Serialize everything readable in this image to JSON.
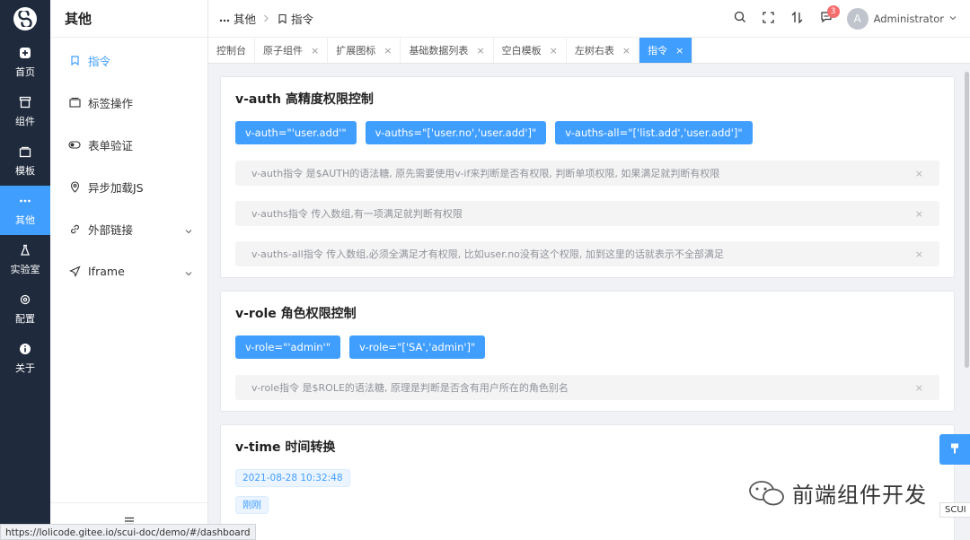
{
  "rail": {
    "items": [
      {
        "label": "首页",
        "icon": "home-icon"
      },
      {
        "label": "组件",
        "icon": "components-icon"
      },
      {
        "label": "模板",
        "icon": "template-icon"
      },
      {
        "label": "其他",
        "icon": "more-icon"
      },
      {
        "label": "实验室",
        "icon": "lab-icon"
      },
      {
        "label": "配置",
        "icon": "gear-icon"
      },
      {
        "label": "关于",
        "icon": "info-icon"
      }
    ],
    "active_index": 3
  },
  "side": {
    "title": "其他",
    "items": [
      {
        "label": "指令"
      },
      {
        "label": "标签操作"
      },
      {
        "label": "表单验证"
      },
      {
        "label": "异步加载JS"
      },
      {
        "label": "外部链接"
      },
      {
        "label": "Iframe"
      }
    ]
  },
  "header": {
    "crumb_root": "其他",
    "crumb_current": "指令",
    "notification_count": "3",
    "user_initial": "A",
    "user_name": "Administrator"
  },
  "tabs": [
    {
      "label": "控制台"
    },
    {
      "label": "原子组件"
    },
    {
      "label": "扩展图标"
    },
    {
      "label": "基础数据列表"
    },
    {
      "label": "空白模板"
    },
    {
      "label": "左树右表"
    },
    {
      "label": "指令"
    }
  ],
  "auth": {
    "title": "v-auth 高精度权限控制",
    "buttons": [
      "v-auth=\"'user.add'\"",
      "v-auths=\"['user.no','user.add']\"",
      "v-auths-all=\"['list.add','user.add']\""
    ],
    "alerts": [
      "v-auth指令 是$AUTH的语法糖, 原先需要使用v-if来判断是否有权限, 判断单项权限, 如果满足就判断有权限",
      "v-auths指令 传入数组,有一项满足就判断有权限",
      "v-auths-all指令 传入数组,必须全满足才有权限, 比如user.no没有这个权限, 加到这里的话就表示不全部满足"
    ]
  },
  "role": {
    "title": "v-role 角色权限控制",
    "buttons": [
      "v-role=\"'admin'\"",
      "v-role=\"['SA','admin']\""
    ],
    "alerts": [
      "v-role指令 是$ROLE的语法糖, 原理是判断是否含有用户所在的角色别名"
    ]
  },
  "time": {
    "title": "v-time 时间转换",
    "tags": [
      "2021-08-28 10:32:48",
      "刚刚"
    ]
  },
  "close_glyph": "×",
  "watermark": "前端组件开发",
  "scui_label": "SCUI",
  "status_url": "https://lolicode.gitee.io/scui-doc/demo/#/dashboard",
  "colors": {
    "accent": "#409eff",
    "rail_bg": "#1f2a3d",
    "badge": "#f56c6c"
  }
}
